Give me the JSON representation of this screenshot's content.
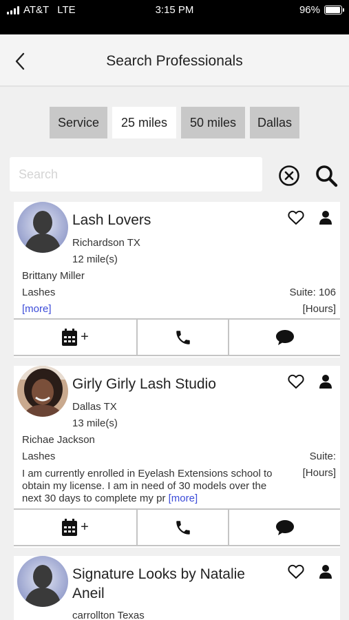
{
  "status": {
    "carrier": "AT&T",
    "network": "LTE",
    "time": "3:15 PM",
    "battery": "96%",
    "battery_level": 0.96
  },
  "header": {
    "title": "Search Professionals",
    "back_icon": "chevron-left-icon"
  },
  "filters": [
    {
      "label": "Service",
      "active": false
    },
    {
      "label": "25 miles",
      "active": true
    },
    {
      "label": "50 miles",
      "active": false
    },
    {
      "label": "Dallas",
      "active": false
    }
  ],
  "search": {
    "placeholder": "Search",
    "value": ""
  },
  "colors": {
    "chip_bg": "#c8c8c8",
    "chip_active_bg": "#ffffff",
    "link": "#3b4bd8",
    "background": "#f0f0f0"
  },
  "results": [
    {
      "name": "Lash Lovers",
      "city": "Richardson TX",
      "distance": "12 mile(s)",
      "owner": "Brittany Miller",
      "service": "Lashes",
      "suite": "Suite: 106",
      "more": "[more]",
      "hours": "[Hours]",
      "avatar": "default-avatar"
    },
    {
      "name": "Girly Girly Lash Studio",
      "city": "Dallas TX",
      "distance": "13 mile(s)",
      "owner": "Richae Jackson",
      "service": "Lashes",
      "suite": "Suite:",
      "description": "I am currently enrolled in Eyelash Extensions school to obtain my license. I am in need of 30 models over the next 30 days to complete my pr",
      "more": "[more]",
      "hours": "[Hours]",
      "avatar": "photo-avatar"
    },
    {
      "name": "Signature Looks by Natalie Aneil",
      "city": "carrollton Texas",
      "avatar": "default-avatar"
    }
  ],
  "actions": {
    "book_icon": "calendar-plus-icon",
    "book_plus": "+",
    "call_icon": "phone-icon",
    "message_icon": "chat-bubble-icon"
  }
}
